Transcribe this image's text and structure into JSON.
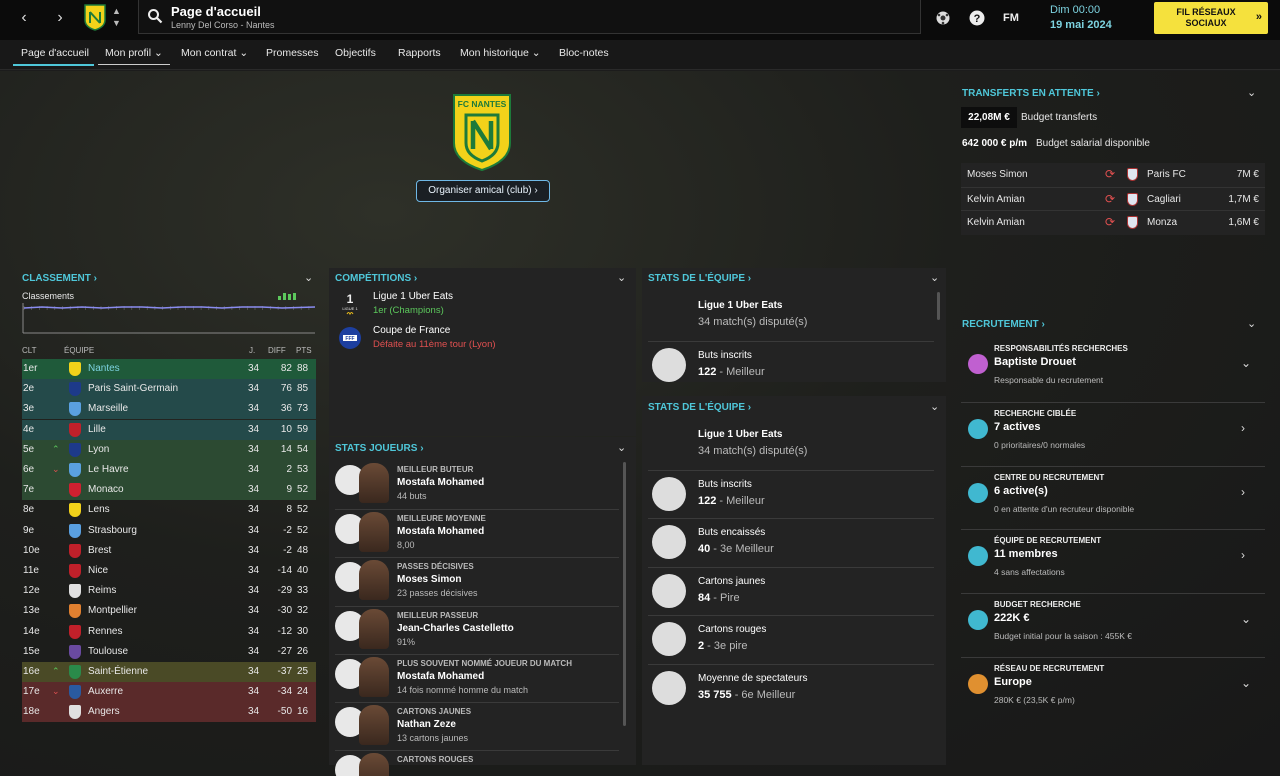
{
  "topbar": {
    "title": "Page d'accueil",
    "subtitle": "Lenny Del Corso - Nantes",
    "fm_label": "FM",
    "day_time": "Dim 00:00",
    "date": "19 mai 2024",
    "social_button": "FIL RÉSEAUX SOCIAUX"
  },
  "nav": {
    "tabs": [
      {
        "label": "Page d'accueil"
      },
      {
        "label": "Mon profil ⌄"
      },
      {
        "label": "Mon contrat ⌄"
      },
      {
        "label": "Promesses"
      },
      {
        "label": "Objectifs"
      },
      {
        "label": "Rapports"
      },
      {
        "label": "Mon historique ⌄"
      },
      {
        "label": "Bloc-notes"
      }
    ]
  },
  "club": {
    "logo_text": "FC NANTES",
    "friendly_button": "Organiser amical (club) ›"
  },
  "transfers": {
    "header": "TRANSFERTS EN ATTENTE ›",
    "budget_value": "22,08M €",
    "budget_label": "Budget transferts",
    "wage_value": "642 000 € p/m",
    "wage_label": "Budget salarial disponible",
    "items": [
      {
        "player": "Moses Simon",
        "club": "Paris FC",
        "fee": "7M €"
      },
      {
        "player": "Kelvin Amian",
        "club": "Cagliari",
        "fee": "1,7M €"
      },
      {
        "player": "Kelvin Amian",
        "club": "Monza",
        "fee": "1,6M €"
      }
    ]
  },
  "standings": {
    "header": "CLASSEMENT ›",
    "sub_label": "Classements",
    "cols": {
      "pos": "CLT",
      "team": "ÉQUIPE",
      "played": "J.",
      "diff": "DIFF",
      "pts": "PTS"
    },
    "rows": [
      {
        "pos": "1er",
        "team": "Nantes",
        "p": "34",
        "diff": "82",
        "pts": "88",
        "mv": ""
      },
      {
        "pos": "2e",
        "team": "Paris Saint-Germain",
        "p": "34",
        "diff": "76",
        "pts": "85",
        "mv": ""
      },
      {
        "pos": "3e",
        "team": "Marseille",
        "p": "34",
        "diff": "36",
        "pts": "73",
        "mv": ""
      },
      {
        "pos": "4e",
        "team": "Lille",
        "p": "34",
        "diff": "10",
        "pts": "59",
        "mv": ""
      },
      {
        "pos": "5e",
        "team": "Lyon",
        "p": "34",
        "diff": "14",
        "pts": "54",
        "mv": "up"
      },
      {
        "pos": "6e",
        "team": "Le Havre",
        "p": "34",
        "diff": "2",
        "pts": "53",
        "mv": "down"
      },
      {
        "pos": "7e",
        "team": "Monaco",
        "p": "34",
        "diff": "9",
        "pts": "52",
        "mv": ""
      },
      {
        "pos": "8e",
        "team": "Lens",
        "p": "34",
        "diff": "8",
        "pts": "52",
        "mv": ""
      },
      {
        "pos": "9e",
        "team": "Strasbourg",
        "p": "34",
        "diff": "-2",
        "pts": "52",
        "mv": ""
      },
      {
        "pos": "10e",
        "team": "Brest",
        "p": "34",
        "diff": "-2",
        "pts": "48",
        "mv": ""
      },
      {
        "pos": "11e",
        "team": "Nice",
        "p": "34",
        "diff": "-14",
        "pts": "40",
        "mv": ""
      },
      {
        "pos": "12e",
        "team": "Reims",
        "p": "34",
        "diff": "-29",
        "pts": "33",
        "mv": ""
      },
      {
        "pos": "13e",
        "team": "Montpellier",
        "p": "34",
        "diff": "-30",
        "pts": "32",
        "mv": ""
      },
      {
        "pos": "14e",
        "team": "Rennes",
        "p": "34",
        "diff": "-12",
        "pts": "30",
        "mv": ""
      },
      {
        "pos": "15e",
        "team": "Toulouse",
        "p": "34",
        "diff": "-27",
        "pts": "26",
        "mv": ""
      },
      {
        "pos": "16e",
        "team": "Saint-Étienne",
        "p": "34",
        "diff": "-37",
        "pts": "25",
        "mv": "up"
      },
      {
        "pos": "17e",
        "team": "Auxerre",
        "p": "34",
        "diff": "-34",
        "pts": "24",
        "mv": "down"
      },
      {
        "pos": "18e",
        "team": "Angers",
        "p": "34",
        "diff": "-50",
        "pts": "16",
        "mv": ""
      }
    ]
  },
  "competitions": {
    "header": "COMPÉTITIONS ›",
    "items": [
      {
        "name": "Ligue 1 Uber Eats",
        "result": "1er (Champions)",
        "color": "#5cc85c"
      },
      {
        "name": "Coupe de France",
        "result": "Défaite au 11ème tour (Lyon)",
        "color": "#e05050"
      }
    ]
  },
  "player_stats": {
    "header": "STATS JOUEURS ›",
    "items": [
      {
        "label": "MEILLEUR BUTEUR",
        "name": "Mostafa Mohamed",
        "sub": "44 buts"
      },
      {
        "label": "MEILLEURE MOYENNE",
        "name": "Mostafa Mohamed",
        "sub": "8,00"
      },
      {
        "label": "PASSES DÉCISIVES",
        "name": "Moses Simon",
        "sub": "23 passes décisives"
      },
      {
        "label": "MEILLEUR PASSEUR",
        "name": "Jean-Charles Castelletto",
        "sub": "91%"
      },
      {
        "label": "PLUS SOUVENT NOMMÉ JOUEUR DU MATCH",
        "name": "Mostafa Mohamed",
        "sub": "14 fois nommé homme du match"
      },
      {
        "label": "CARTONS JAUNES",
        "name": "Nathan Zeze",
        "sub": "13 cartons jaunes"
      },
      {
        "label": "CARTONS ROUGES",
        "name": "",
        "sub": ""
      }
    ]
  },
  "team_stats_1": {
    "header": "STATS DE L'ÉQUIPE ›",
    "items": [
      {
        "title": "Ligue 1 Uber Eats",
        "value": "34 match(s) disputé(s)",
        "bold": ""
      },
      {
        "title": "Buts inscrits",
        "bold": "122",
        "value": " - Meilleur"
      }
    ]
  },
  "team_stats_2": {
    "header": "STATS DE L'ÉQUIPE ›",
    "items": [
      {
        "title": "Ligue 1 Uber Eats",
        "bold": "",
        "value": "34 match(s) disputé(s)"
      },
      {
        "title": "Buts inscrits",
        "bold": "122",
        "value": " - Meilleur"
      },
      {
        "title": "Buts encaissés",
        "bold": "40",
        "value": " - 3e Meilleur"
      },
      {
        "title": "Cartons jaunes",
        "bold": "84",
        "value": " - Pire"
      },
      {
        "title": "Cartons rouges",
        "bold": "2",
        "value": " - 3e pire"
      },
      {
        "title": "Moyenne de spectateurs",
        "bold": "35 755",
        "value": " - 6e Meilleur"
      }
    ]
  },
  "recruitment": {
    "header": "RECRUTEMENT ›",
    "items": [
      {
        "label": "RESPONSABILITÉS RECHERCHES",
        "value": "Baptiste Drouet",
        "sub": "Responsable du recrutement",
        "color": "#c060d0"
      },
      {
        "label": "RECHERCHE CIBLÉE",
        "value": "7 actives",
        "sub": "0 prioritaires/0 normales",
        "color": "#40b8d0"
      },
      {
        "label": "CENTRE DU RECRUTEMENT",
        "value": "6 active(s)",
        "sub": "0 en attente d'un recruteur disponible",
        "color": "#40b8d0"
      },
      {
        "label": "ÉQUIPE DE RECRUTEMENT",
        "value": "11 membres",
        "sub": "4 sans affectations",
        "color": "#40b8d0"
      },
      {
        "label": "BUDGET RECHERCHE",
        "value": "222K €",
        "sub": "Budget initial pour la saison : 455K €",
        "color": "#40b8d0"
      },
      {
        "label": "RÉSEAU DE RECRUTEMENT",
        "value": "Europe",
        "sub": "280K € (23,5K € p/m)",
        "color": "#e09030"
      }
    ]
  }
}
